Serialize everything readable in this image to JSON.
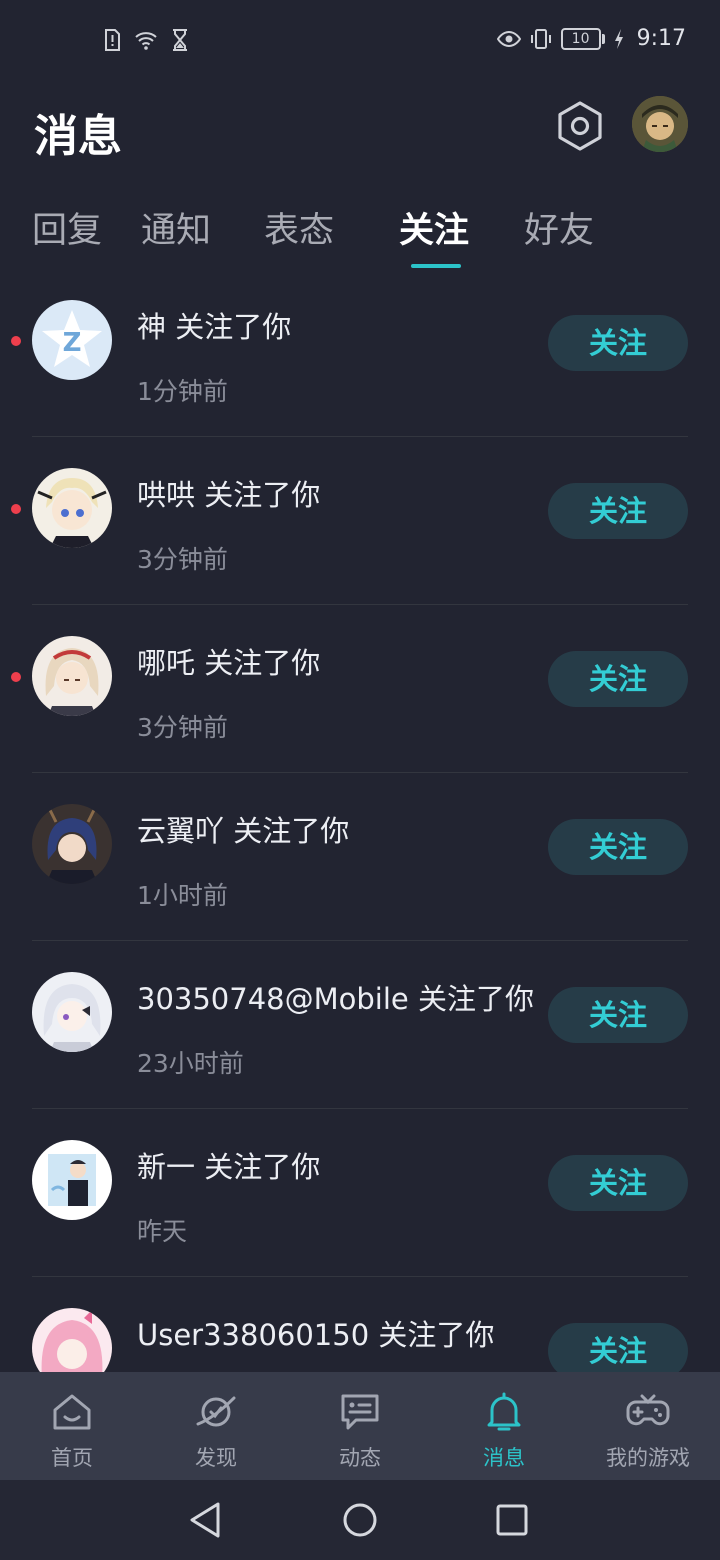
{
  "status_bar": {
    "time": "9:17",
    "battery_level": "10",
    "left_icons": [
      "alert-sim-icon",
      "wifi-icon",
      "hourglass-icon"
    ],
    "right_icons": [
      "eye-icon",
      "vibrate-icon",
      "battery-icon",
      "charging-icon"
    ]
  },
  "header": {
    "title": "消息"
  },
  "tabs": [
    {
      "label": "回复",
      "active": false
    },
    {
      "label": "通知",
      "active": false
    },
    {
      "label": "表态",
      "active": false
    },
    {
      "label": "关注",
      "active": true
    },
    {
      "label": "好友",
      "active": false
    }
  ],
  "notifications": [
    {
      "title": "神 关注了你",
      "time": "1分钟前",
      "unread": true,
      "button": "关注"
    },
    {
      "title": "哄哄 关注了你",
      "time": "3分钟前",
      "unread": true,
      "button": "关注"
    },
    {
      "title": "哪吒 关注了你",
      "time": "3分钟前",
      "unread": true,
      "button": "关注"
    },
    {
      "title": "云翼吖 关注了你",
      "time": "1小时前",
      "unread": false,
      "button": "关注"
    },
    {
      "title": "30350748@Mobile 关注了你",
      "time": "23小时前",
      "unread": false,
      "button": "关注"
    },
    {
      "title": "新一 关注了你",
      "time": "昨天",
      "unread": false,
      "button": "关注"
    },
    {
      "title": "User338060150 关注了你",
      "time": "",
      "unread": false,
      "button": "关注"
    }
  ],
  "bottom_nav": [
    {
      "label": "首页",
      "icon": "home-icon",
      "active": false
    },
    {
      "label": "发现",
      "icon": "planet-icon",
      "active": false
    },
    {
      "label": "动态",
      "icon": "chat-bubble-icon",
      "active": false
    },
    {
      "label": "消息",
      "icon": "bell-icon",
      "active": true
    },
    {
      "label": "我的游戏",
      "icon": "gamepad-icon",
      "active": false
    }
  ],
  "colors": {
    "background": "#222431",
    "accent": "#2cc3c9",
    "unread_dot": "#ee3f4d",
    "follow_button_bg": "#263c48",
    "nav_bar": "#373b4a"
  }
}
